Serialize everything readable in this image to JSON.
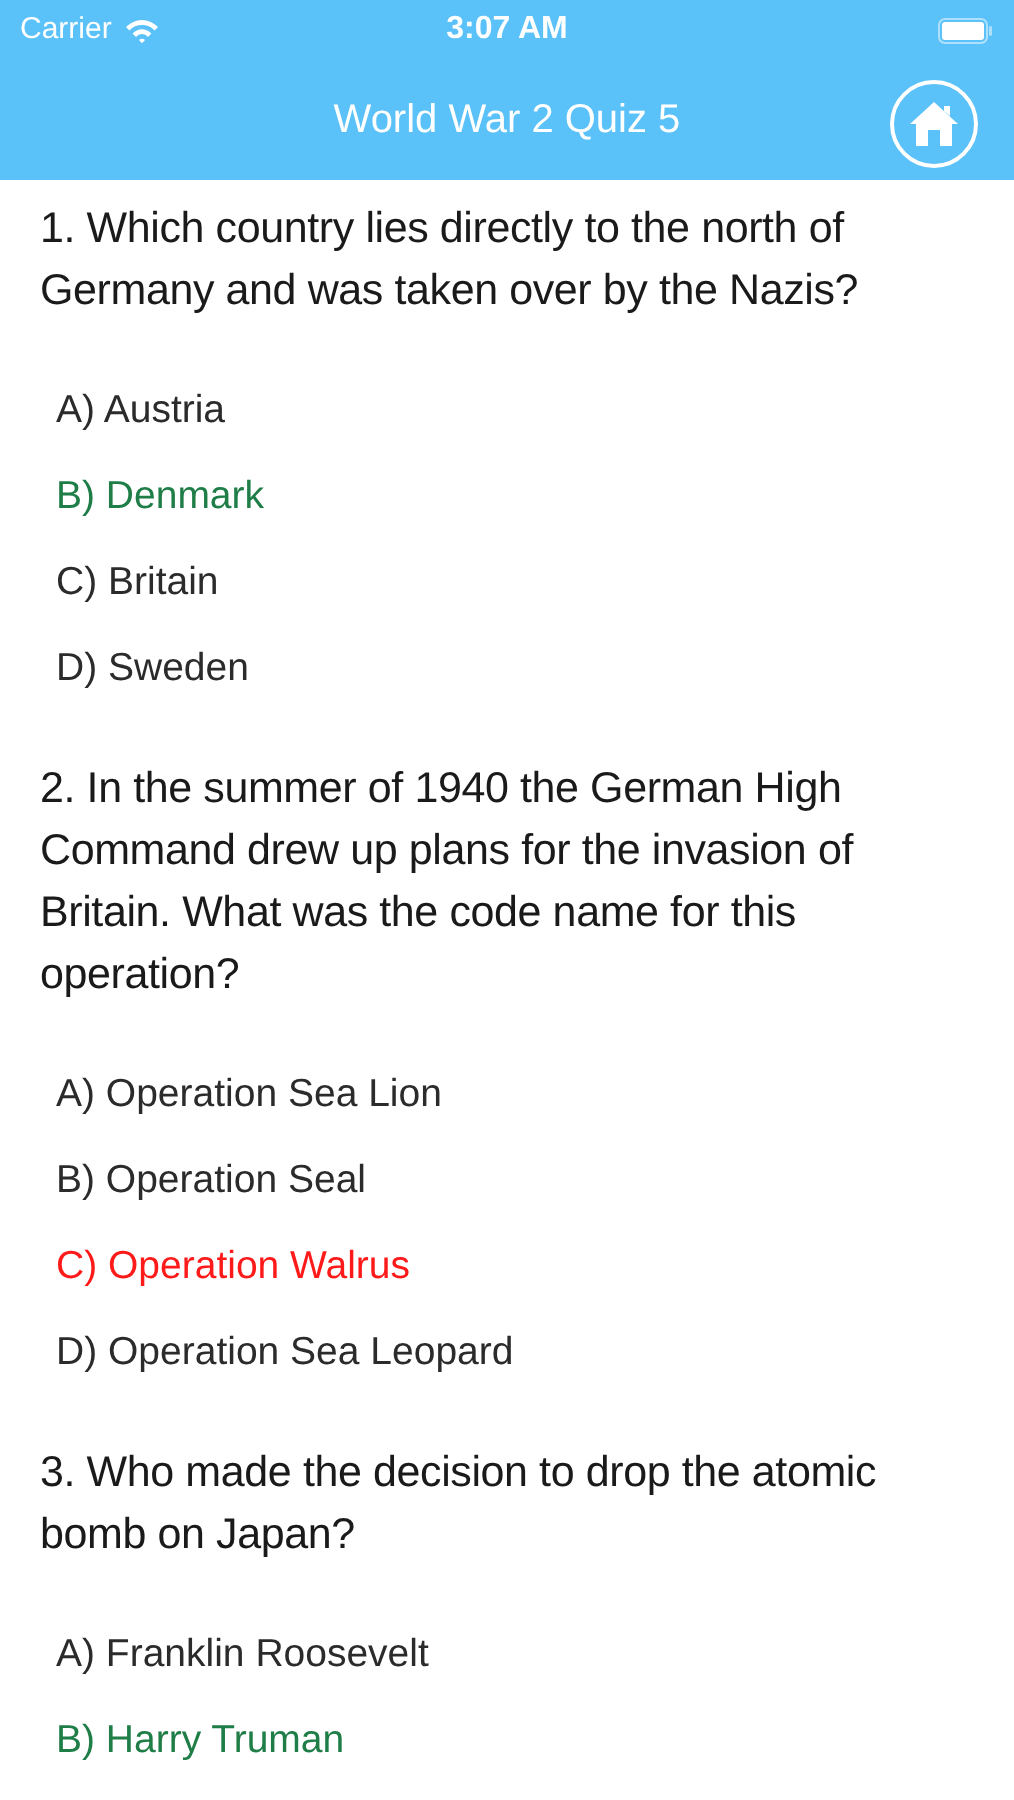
{
  "status_bar": {
    "carrier": "Carrier",
    "time": "3:07 AM"
  },
  "nav": {
    "title": "World War 2 Quiz 5"
  },
  "questions": [
    {
      "text": "1. Which country lies directly to the north of Germany and was taken over by the Nazis?",
      "options": [
        {
          "label": "A) Austria",
          "correct": false,
          "wrong": false
        },
        {
          "label": "B) Denmark",
          "correct": true,
          "wrong": false
        },
        {
          "label": "C) Britain",
          "correct": false,
          "wrong": false
        },
        {
          "label": "D) Sweden",
          "correct": false,
          "wrong": false
        }
      ]
    },
    {
      "text": "2. In the summer of 1940 the German High Command drew up plans for the invasion of Britain. What was the code name for this operation?",
      "options": [
        {
          "label": "A) Operation Sea Lion",
          "correct": false,
          "wrong": false
        },
        {
          "label": "B) Operation Seal",
          "correct": false,
          "wrong": false
        },
        {
          "label": "C) Operation Walrus",
          "correct": false,
          "wrong": true
        },
        {
          "label": "D) Operation Sea Leopard",
          "correct": false,
          "wrong": false
        }
      ]
    },
    {
      "text": "3. Who made the decision to drop the atomic bomb on Japan?",
      "options": [
        {
          "label": "A) Franklin Roosevelt",
          "correct": false,
          "wrong": false
        },
        {
          "label": "B) Harry Truman",
          "correct": true,
          "wrong": false
        }
      ]
    }
  ]
}
